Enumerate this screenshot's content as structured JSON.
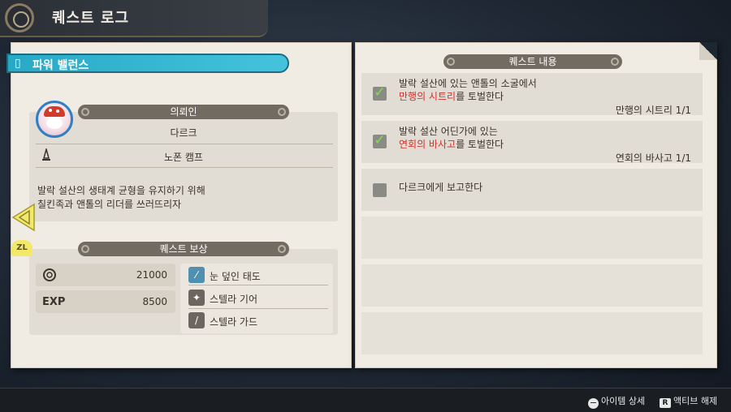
{
  "header": {
    "title": "퀘스트 로그"
  },
  "quest": {
    "name": "파워 밸런스"
  },
  "client": {
    "section_title": "의뢰인",
    "name": "다르크",
    "location": "노폰 캠프",
    "description_line1": "발락 설산의 생태계 균형을 유지하기 위해",
    "description_line2": "칠킨족과 앤톨의 리더를 쓰러뜨리자"
  },
  "rewards": {
    "section_title": "퀘스트 보상",
    "gold": "21000",
    "exp_label": "EXP",
    "exp": "8500",
    "items": [
      {
        "name": "눈 덮인 태도",
        "icon": "sword-icon"
      },
      {
        "name": "스텔라 기어",
        "icon": "gear-icon"
      },
      {
        "name": "스텔라 가드",
        "icon": "guard-icon"
      }
    ]
  },
  "objectives": {
    "section_title": "퀘스트 내용",
    "items": [
      {
        "line1": "발락 설산에 있는 앤톨의 소굴에서",
        "highlight": "만행의 시트리",
        "line2_rest": "를 토벌한다",
        "progress": "만행의 시트리 1/1",
        "done": true
      },
      {
        "line1": "발락 설산 어딘가에 있는",
        "highlight": "연회의 바사고",
        "line2_rest": "를 토벌한다",
        "progress": "연회의 바사고 1/1",
        "done": true
      },
      {
        "line1": "다르크에게 보고한다",
        "done": false
      }
    ]
  },
  "nav": {
    "zl_label": "ZL"
  },
  "footer": {
    "item_detail": "아이템 상세",
    "item_detail_button": "−",
    "deactivate": "액티브 해제",
    "deactivate_button": "R"
  },
  "colors": {
    "accent": "#36b4d0",
    "highlight_red": "#d0302a",
    "check_green": "#7de04a"
  }
}
